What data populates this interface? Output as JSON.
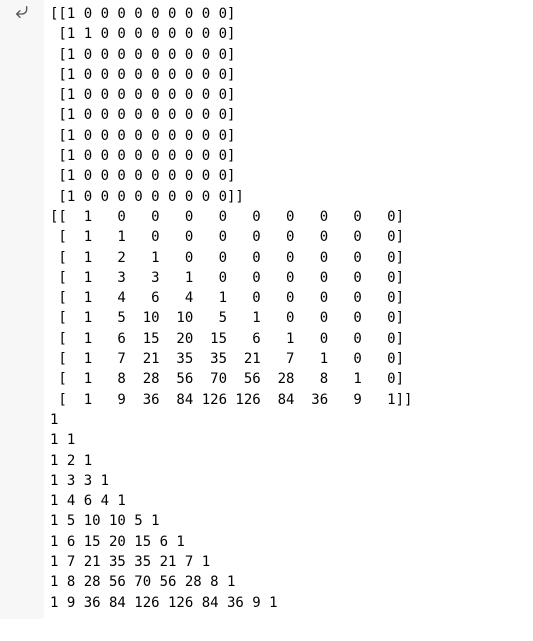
{
  "output": {
    "lines": [
      "[[1 0 0 0 0 0 0 0 0 0]",
      " [1 1 0 0 0 0 0 0 0 0]",
      " [1 0 0 0 0 0 0 0 0 0]",
      " [1 0 0 0 0 0 0 0 0 0]",
      " [1 0 0 0 0 0 0 0 0 0]",
      " [1 0 0 0 0 0 0 0 0 0]",
      " [1 0 0 0 0 0 0 0 0 0]",
      " [1 0 0 0 0 0 0 0 0 0]",
      " [1 0 0 0 0 0 0 0 0 0]",
      " [1 0 0 0 0 0 0 0 0 0]]",
      "[[  1   0   0   0   0   0   0   0   0   0]",
      " [  1   1   0   0   0   0   0   0   0   0]",
      " [  1   2   1   0   0   0   0   0   0   0]",
      " [  1   3   3   1   0   0   0   0   0   0]",
      " [  1   4   6   4   1   0   0   0   0   0]",
      " [  1   5  10  10   5   1   0   0   0   0]",
      " [  1   6  15  20  15   6   1   0   0   0]",
      " [  1   7  21  35  35  21   7   1   0   0]",
      " [  1   8  28  56  70  56  28   8   1   0]",
      " [  1   9  36  84 126 126  84  36   9   1]]",
      "1 ",
      "1 1 ",
      "1 2 1 ",
      "1 3 3 1 ",
      "1 4 6 4 1 ",
      "1 5 10 10 5 1 ",
      "1 6 15 20 15 6 1 ",
      "1 7 21 35 35 21 7 1 ",
      "1 8 28 56 70 56 28 8 1 ",
      "1 9 36 84 126 126 84 36 9 1 "
    ]
  }
}
